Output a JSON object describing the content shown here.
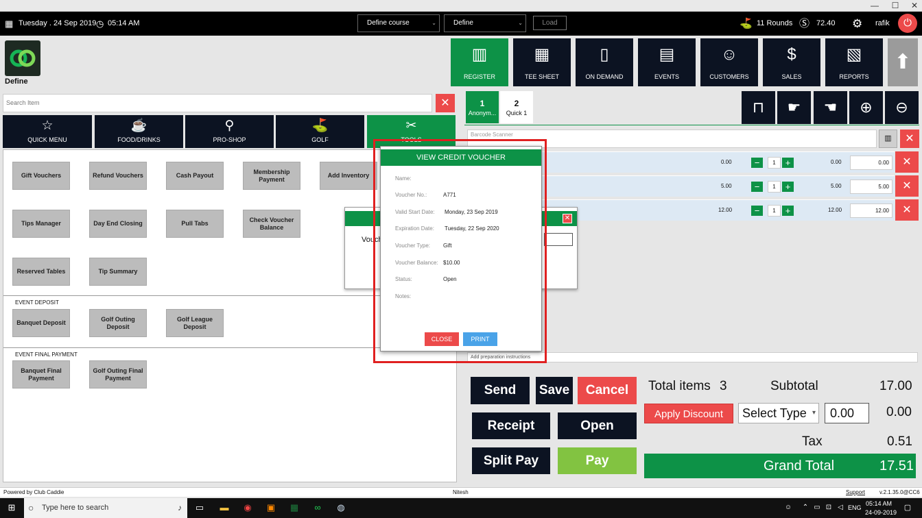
{
  "window": {
    "minimize": "—",
    "maximize": "☐",
    "close": "✕"
  },
  "topbar": {
    "date": "Tuesday .  24 Sep 2019",
    "time": "05:14 AM",
    "course_select": "Define course",
    "define_select": "Define",
    "load_label": "Load",
    "rounds": "11 Rounds",
    "balance": "72.40",
    "user": "rafik"
  },
  "brand": {
    "name": "Define"
  },
  "nav": [
    {
      "label": "REGISTER",
      "icon": "barcode-scanner-icon"
    },
    {
      "label": "TEE SHEET",
      "icon": "calendar-icon"
    },
    {
      "label": "ON DEMAND",
      "icon": "mobile-icon"
    },
    {
      "label": "EVENTS",
      "icon": "events-calendar-icon"
    },
    {
      "label": "CUSTOMERS",
      "icon": "customers-icon"
    },
    {
      "label": "SALES",
      "icon": "sales-icon"
    },
    {
      "label": "REPORTS",
      "icon": "reports-icon"
    }
  ],
  "search": {
    "placeholder": "Search Item"
  },
  "categories": [
    {
      "label": "QUICK MENU"
    },
    {
      "label": "FOOD/DRINKS"
    },
    {
      "label": "PRO-SHOP"
    },
    {
      "label": "GOLF"
    },
    {
      "label": "TOOLS"
    }
  ],
  "tools": {
    "row1": [
      "Gift Vouchers",
      "Refund Vouchers",
      "Cash Payout",
      "Membership Payment",
      "Add Inventory"
    ],
    "row2": [
      "Tips Manager",
      "Day End Closing",
      "Pull Tabs",
      "Check Voucher Balance"
    ],
    "row3": [
      "Reserved Tables",
      "Tip Summary"
    ],
    "event_deposit_title": "EVENT DEPOSIT",
    "event_deposit": [
      "Banquet Deposit",
      "Golf Outing Deposit",
      "Golf League Deposit"
    ],
    "event_final_title": "EVENT FINAL PAYMENT",
    "event_final": [
      "Banquet Final Payment",
      "Golf Outing Final Payment"
    ]
  },
  "tabs": [
    {
      "number": "1",
      "label": "Anonym..."
    },
    {
      "number": "2",
      "label": "Quick 1"
    }
  ],
  "barcode": {
    "placeholder": "Barcode Scanner"
  },
  "items": [
    {
      "price": "0.00",
      "qty": "1",
      "total": "0.00",
      "amount": "0.00"
    },
    {
      "price": "5.00",
      "qty": "1",
      "total": "5.00",
      "amount": "5.00"
    },
    {
      "price": "12.00",
      "qty": "1",
      "total": "12.00",
      "amount": "12.00"
    }
  ],
  "prep": {
    "placeholder": "Add preparation instructions"
  },
  "actions": {
    "send": "Send",
    "save": "Save",
    "cancel": "Cancel",
    "receipt": "Receipt",
    "open": "Open",
    "split_pay": "Split Pay",
    "pay": "Pay"
  },
  "totals": {
    "total_items_label": "Total items",
    "total_items": "3",
    "subtotal_label": "Subtotal",
    "subtotal": "17.00",
    "apply_discount": "Apply Discount",
    "select_type": "Select Type",
    "discount_input": "0.00",
    "discount": "0.00",
    "tax_label": "Tax",
    "tax": "0.51",
    "grand_total_label": "Grand Total",
    "grand_total": "17.51"
  },
  "bg_dialog": {
    "text": "Vouch"
  },
  "voucher": {
    "title": "VIEW CREDIT VOUCHER",
    "name_label": "Name:",
    "name": "",
    "no_label": "Voucher No.:",
    "no": "A771",
    "start_label": "Valid Start Date:",
    "start": "Monday, 23 Sep 2019",
    "exp_label": "Expiration Date:",
    "exp": "Tuesday, 22 Sep 2020",
    "type_label": "Voucher Type:",
    "type": "Gift",
    "balance_label": "Voucher Balance:",
    "balance": "$10.00",
    "status_label": "Status:",
    "status": "Open",
    "notes_label": "Notes:",
    "close": "CLOSE",
    "print": "PRINT"
  },
  "footer": {
    "powered": "Powered by Club Caddie",
    "user": "Nitesh",
    "support": "Support",
    "version": "v.2.1.35.0@CC6"
  },
  "taskbar": {
    "search": "Type here to search",
    "lang": "ENG",
    "time": "05:14 AM",
    "date": "24-09-2019"
  },
  "colors": {
    "green": "#0d9247",
    "red": "#ec4a4a",
    "navy": "#0c1322",
    "lightgreen": "#82c341"
  }
}
